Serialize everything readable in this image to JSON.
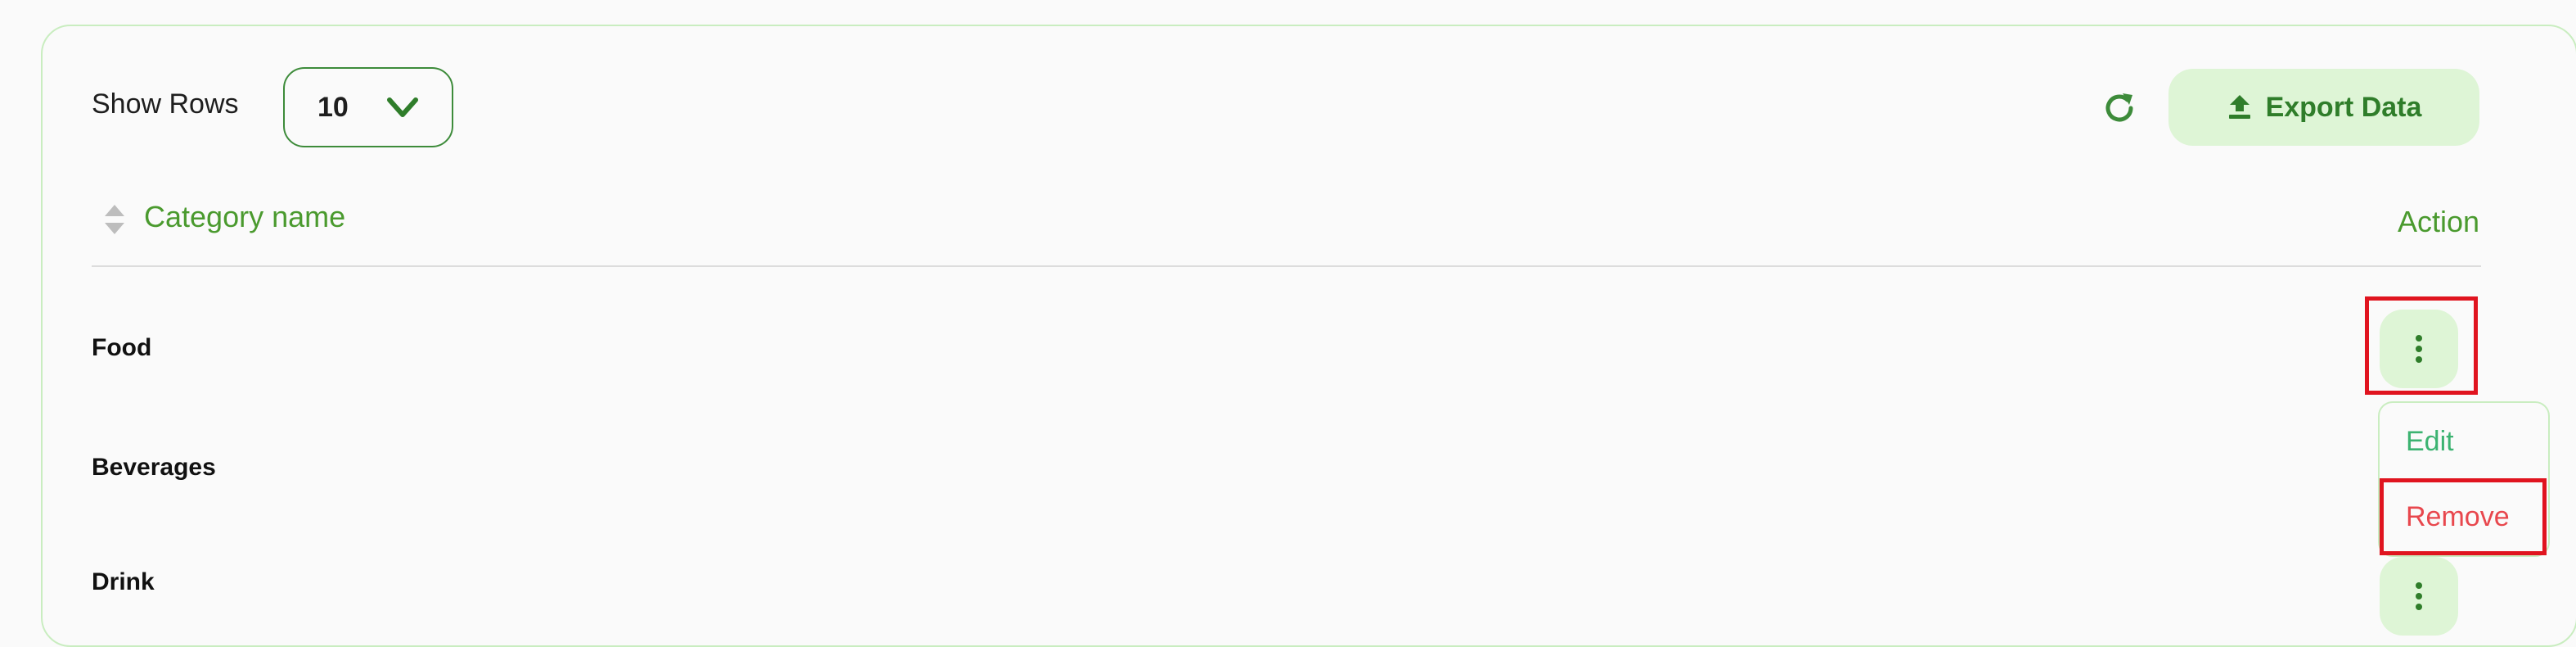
{
  "toolbar": {
    "show_rows_label": "Show Rows",
    "rows_value": "10",
    "export_label": "Export Data"
  },
  "table": {
    "columns": {
      "name": "Category name",
      "action": "Action"
    },
    "rows": [
      {
        "name": "Food"
      },
      {
        "name": "Beverages"
      },
      {
        "name": "Drink"
      }
    ]
  },
  "menu": {
    "edit_label": "Edit",
    "remove_label": "Remove"
  },
  "colors": {
    "accent": "#3d8b3a",
    "accent_light": "#def5d6",
    "danger": "#e8474d",
    "highlight": "#e0141f"
  },
  "icons": {
    "dropdown": "chevron-down-icon",
    "refresh": "refresh-icon",
    "export": "upload-icon",
    "sort": "sort-icon",
    "row_actions": "kebab-menu-icon"
  }
}
